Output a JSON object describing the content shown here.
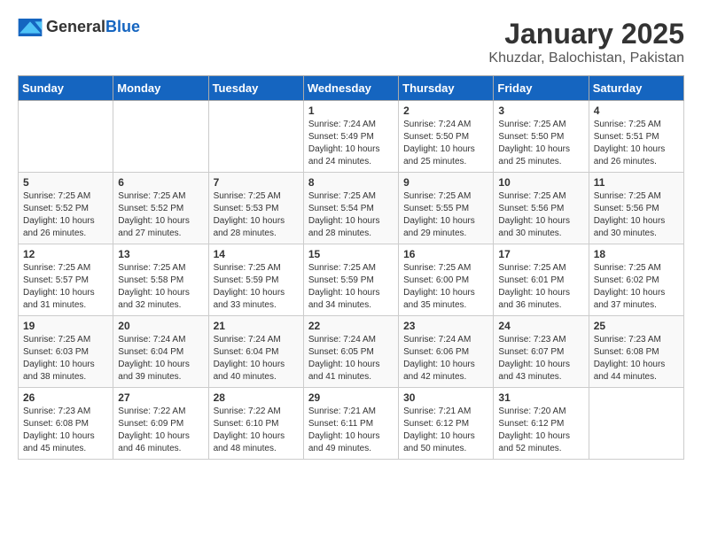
{
  "header": {
    "logo_general": "General",
    "logo_blue": "Blue",
    "title": "January 2025",
    "subtitle": "Khuzdar, Balochistan, Pakistan"
  },
  "weekdays": [
    "Sunday",
    "Monday",
    "Tuesday",
    "Wednesday",
    "Thursday",
    "Friday",
    "Saturday"
  ],
  "weeks": [
    [
      {
        "day": "",
        "info": ""
      },
      {
        "day": "",
        "info": ""
      },
      {
        "day": "",
        "info": ""
      },
      {
        "day": "1",
        "info": "Sunrise: 7:24 AM\nSunset: 5:49 PM\nDaylight: 10 hours\nand 24 minutes."
      },
      {
        "day": "2",
        "info": "Sunrise: 7:24 AM\nSunset: 5:50 PM\nDaylight: 10 hours\nand 25 minutes."
      },
      {
        "day": "3",
        "info": "Sunrise: 7:25 AM\nSunset: 5:50 PM\nDaylight: 10 hours\nand 25 minutes."
      },
      {
        "day": "4",
        "info": "Sunrise: 7:25 AM\nSunset: 5:51 PM\nDaylight: 10 hours\nand 26 minutes."
      }
    ],
    [
      {
        "day": "5",
        "info": "Sunrise: 7:25 AM\nSunset: 5:52 PM\nDaylight: 10 hours\nand 26 minutes."
      },
      {
        "day": "6",
        "info": "Sunrise: 7:25 AM\nSunset: 5:52 PM\nDaylight: 10 hours\nand 27 minutes."
      },
      {
        "day": "7",
        "info": "Sunrise: 7:25 AM\nSunset: 5:53 PM\nDaylight: 10 hours\nand 28 minutes."
      },
      {
        "day": "8",
        "info": "Sunrise: 7:25 AM\nSunset: 5:54 PM\nDaylight: 10 hours\nand 28 minutes."
      },
      {
        "day": "9",
        "info": "Sunrise: 7:25 AM\nSunset: 5:55 PM\nDaylight: 10 hours\nand 29 minutes."
      },
      {
        "day": "10",
        "info": "Sunrise: 7:25 AM\nSunset: 5:56 PM\nDaylight: 10 hours\nand 30 minutes."
      },
      {
        "day": "11",
        "info": "Sunrise: 7:25 AM\nSunset: 5:56 PM\nDaylight: 10 hours\nand 30 minutes."
      }
    ],
    [
      {
        "day": "12",
        "info": "Sunrise: 7:25 AM\nSunset: 5:57 PM\nDaylight: 10 hours\nand 31 minutes."
      },
      {
        "day": "13",
        "info": "Sunrise: 7:25 AM\nSunset: 5:58 PM\nDaylight: 10 hours\nand 32 minutes."
      },
      {
        "day": "14",
        "info": "Sunrise: 7:25 AM\nSunset: 5:59 PM\nDaylight: 10 hours\nand 33 minutes."
      },
      {
        "day": "15",
        "info": "Sunrise: 7:25 AM\nSunset: 5:59 PM\nDaylight: 10 hours\nand 34 minutes."
      },
      {
        "day": "16",
        "info": "Sunrise: 7:25 AM\nSunset: 6:00 PM\nDaylight: 10 hours\nand 35 minutes."
      },
      {
        "day": "17",
        "info": "Sunrise: 7:25 AM\nSunset: 6:01 PM\nDaylight: 10 hours\nand 36 minutes."
      },
      {
        "day": "18",
        "info": "Sunrise: 7:25 AM\nSunset: 6:02 PM\nDaylight: 10 hours\nand 37 minutes."
      }
    ],
    [
      {
        "day": "19",
        "info": "Sunrise: 7:25 AM\nSunset: 6:03 PM\nDaylight: 10 hours\nand 38 minutes."
      },
      {
        "day": "20",
        "info": "Sunrise: 7:24 AM\nSunset: 6:04 PM\nDaylight: 10 hours\nand 39 minutes."
      },
      {
        "day": "21",
        "info": "Sunrise: 7:24 AM\nSunset: 6:04 PM\nDaylight: 10 hours\nand 40 minutes."
      },
      {
        "day": "22",
        "info": "Sunrise: 7:24 AM\nSunset: 6:05 PM\nDaylight: 10 hours\nand 41 minutes."
      },
      {
        "day": "23",
        "info": "Sunrise: 7:24 AM\nSunset: 6:06 PM\nDaylight: 10 hours\nand 42 minutes."
      },
      {
        "day": "24",
        "info": "Sunrise: 7:23 AM\nSunset: 6:07 PM\nDaylight: 10 hours\nand 43 minutes."
      },
      {
        "day": "25",
        "info": "Sunrise: 7:23 AM\nSunset: 6:08 PM\nDaylight: 10 hours\nand 44 minutes."
      }
    ],
    [
      {
        "day": "26",
        "info": "Sunrise: 7:23 AM\nSunset: 6:08 PM\nDaylight: 10 hours\nand 45 minutes."
      },
      {
        "day": "27",
        "info": "Sunrise: 7:22 AM\nSunset: 6:09 PM\nDaylight: 10 hours\nand 46 minutes."
      },
      {
        "day": "28",
        "info": "Sunrise: 7:22 AM\nSunset: 6:10 PM\nDaylight: 10 hours\nand 48 minutes."
      },
      {
        "day": "29",
        "info": "Sunrise: 7:21 AM\nSunset: 6:11 PM\nDaylight: 10 hours\nand 49 minutes."
      },
      {
        "day": "30",
        "info": "Sunrise: 7:21 AM\nSunset: 6:12 PM\nDaylight: 10 hours\nand 50 minutes."
      },
      {
        "day": "31",
        "info": "Sunrise: 7:20 AM\nSunset: 6:12 PM\nDaylight: 10 hours\nand 52 minutes."
      },
      {
        "day": "",
        "info": ""
      }
    ]
  ]
}
